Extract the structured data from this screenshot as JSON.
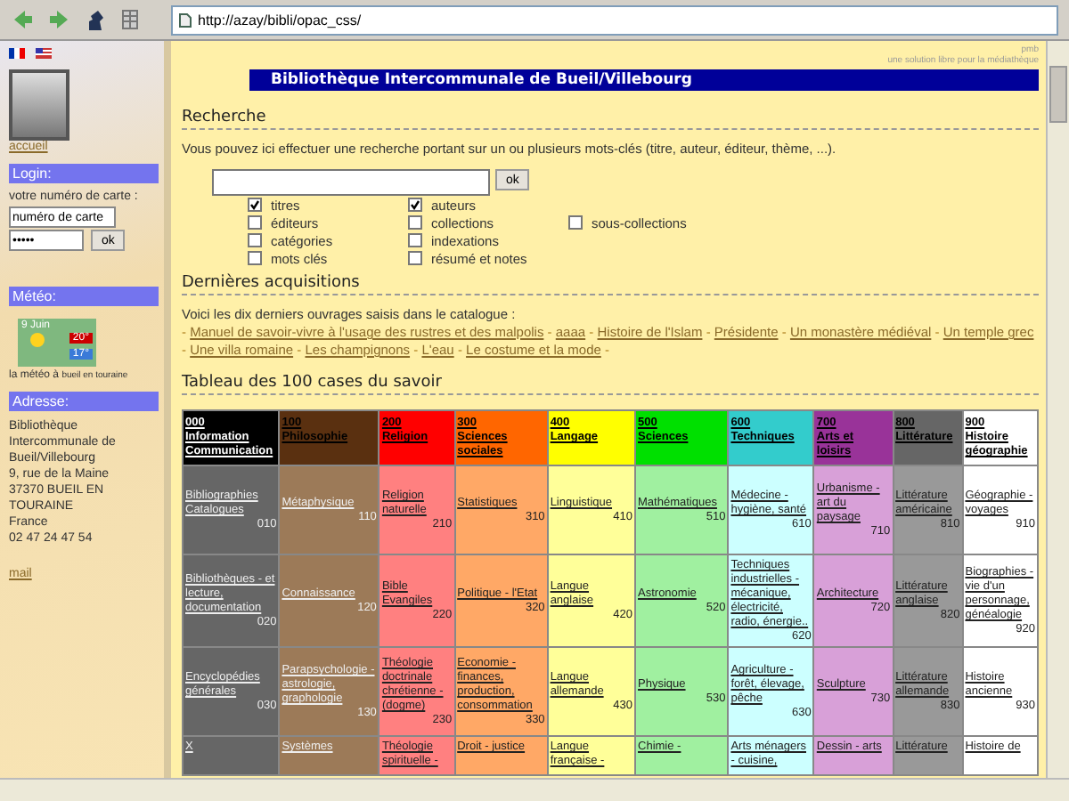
{
  "browser": {
    "url": "http://azay/bibli/opac_css/"
  },
  "sidebar": {
    "home_link": "accueil",
    "login": {
      "title": "Login:",
      "prompt": "votre numéro de carte :",
      "card_value": "numéro de carte",
      "password_value": "•••••",
      "button": "ok"
    },
    "weather": {
      "title": "Météo:",
      "date": "9 Juin",
      "high": "20°",
      "low": "17°",
      "caption": "la météo à",
      "place": "bueil en touraine"
    },
    "address": {
      "title": "Adresse:",
      "lines": [
        "Bibliothèque",
        "Intercommunale de",
        "Bueil/Villebourg",
        "9, rue de la Maine",
        "37370 BUEIL EN",
        "TOURAINE",
        "France",
        "02 47 24 47 54"
      ],
      "mail": "mail"
    }
  },
  "credit": {
    "brand": "pmb",
    "tagline": "une solution libre pour la médiathèque"
  },
  "title": "Bibliothèque Intercommunale de Bueil/Villebourg",
  "search": {
    "heading": "Recherche",
    "intro": "Vous pouvez ici effectuer une recherche portant sur un ou plusieurs mots-clés (titre, auteur, éditeur, thème, ...).",
    "button": "ok",
    "option_rows": [
      [
        {
          "label": "titres",
          "checked": true
        },
        {
          "label": "auteurs",
          "checked": true
        }
      ],
      [
        {
          "label": "éditeurs",
          "checked": false
        },
        {
          "label": "collections",
          "checked": false
        },
        {
          "label": "sous-collections",
          "checked": false
        }
      ],
      [
        {
          "label": "catégories",
          "checked": false
        },
        {
          "label": "indexations",
          "checked": false
        }
      ],
      [
        {
          "label": "mots clés",
          "checked": false
        },
        {
          "label": "résumé et notes",
          "checked": false
        }
      ]
    ]
  },
  "acquisitions": {
    "heading": "Dernières acquisitions",
    "intro": "Voici les dix derniers ouvrages saisis dans le catalogue :",
    "separator": "-",
    "titles": [
      "Manuel de savoir-vivre à l'usage des rustres et des malpolis",
      "aaaa",
      "Histoire de l'Islam",
      "Présidente",
      "Un monastère médiéval",
      "Un temple grec",
      "Une villa romaine",
      "Les champignons",
      "L'eau",
      "Le costume et la mode"
    ]
  },
  "knowledge": {
    "heading": "Tableau des 100 cases du savoir",
    "columns": [
      {
        "number": "000",
        "label": "Information Communication",
        "color": "#000000"
      },
      {
        "number": "100",
        "label": "Philosophie",
        "color": "#5a3010"
      },
      {
        "number": "200",
        "label": "Religion",
        "color": "#ff0000"
      },
      {
        "number": "300",
        "label": "Sciences sociales",
        "color": "#ff6600"
      },
      {
        "number": "400",
        "label": "Langage",
        "color": "#ffff00"
      },
      {
        "number": "500",
        "label": "Sciences",
        "color": "#00e000"
      },
      {
        "number": "600",
        "label": "Techniques",
        "color": "#33cccc"
      },
      {
        "number": "700",
        "label": "Arts et loisirs",
        "color": "#993399"
      },
      {
        "number": "800",
        "label": "Littérature",
        "color": "#666666"
      },
      {
        "number": "900",
        "label": "Histoire géographie",
        "color": "#ffffff"
      }
    ],
    "rows": [
      [
        {
          "text": "Bibliographies Catalogues",
          "code": "010",
          "color": "#666666"
        },
        {
          "text": "Métaphysique",
          "code": "110",
          "color": "#9c7a58"
        },
        {
          "text": "Religion naturelle",
          "code": "210",
          "color": "#ff8080"
        },
        {
          "text": "Statistiques",
          "code": "310",
          "color": "#ffa866"
        },
        {
          "text": "Linguistique",
          "code": "410",
          "color": "#ffff99"
        },
        {
          "text": "Mathématiques",
          "code": "510",
          "color": "#a0f0a0"
        },
        {
          "text": "Médecine - hygiène, santé",
          "code": "610",
          "color": "#ccffff"
        },
        {
          "text": "Urbanisme - art du paysage",
          "code": "710",
          "color": "#d8a0d8"
        },
        {
          "text": "Littérature américaine",
          "code": "810",
          "color": "#999999"
        },
        {
          "text": "Géographie - voyages",
          "code": "910",
          "color": "#ffffff"
        }
      ],
      [
        {
          "text": "Bibliothèques - et lecture, documentation",
          "code": "020",
          "color": "#666666"
        },
        {
          "text": "Connaissance",
          "code": "120",
          "color": "#9c7a58"
        },
        {
          "text": "Bible Evangiles",
          "code": "220",
          "color": "#ff8080"
        },
        {
          "text": "Politique - l'Etat",
          "code": "320",
          "color": "#ffa866"
        },
        {
          "text": "Langue anglaise",
          "code": "420",
          "color": "#ffff99"
        },
        {
          "text": "Astronomie",
          "code": "520",
          "color": "#a0f0a0"
        },
        {
          "text": "Techniques industrielles - mécanique, électricité, radio, énergie..",
          "code": "620",
          "color": "#ccffff"
        },
        {
          "text": "Architecture",
          "code": "720",
          "color": "#d8a0d8"
        },
        {
          "text": "Littérature anglaise",
          "code": "820",
          "color": "#999999"
        },
        {
          "text": "Biographies - vie d'un personnage, généalogie",
          "code": "920",
          "color": "#ffffff"
        }
      ],
      [
        {
          "text": "Encyclopédies générales",
          "code": "030",
          "color": "#666666"
        },
        {
          "text": "Parapsychologie - astrologie, graphologie",
          "code": "130",
          "color": "#9c7a58"
        },
        {
          "text": "Théologie doctrinale chrétienne - (dogme)",
          "code": "230",
          "color": "#ff8080"
        },
        {
          "text": "Economie - finances, production, consommation",
          "code": "330",
          "color": "#ffa866"
        },
        {
          "text": "Langue allemande",
          "code": "430",
          "color": "#ffff99"
        },
        {
          "text": "Physique",
          "code": "530",
          "color": "#a0f0a0"
        },
        {
          "text": "Agriculture - forêt, élevage, pêche",
          "code": "630",
          "color": "#ccffff"
        },
        {
          "text": "Sculpture",
          "code": "730",
          "color": "#d8a0d8"
        },
        {
          "text": "Littérature allemande",
          "code": "830",
          "color": "#999999"
        },
        {
          "text": "Histoire ancienne",
          "code": "930",
          "color": "#ffffff"
        }
      ],
      [
        {
          "text": "X",
          "color": "#666666"
        },
        {
          "text": "Systèmes",
          "color": "#9c7a58"
        },
        {
          "text": "Théologie spirituelle -",
          "color": "#ff8080"
        },
        {
          "text": "Droit - justice",
          "color": "#ffa866"
        },
        {
          "text": "Langue française -",
          "color": "#ffff99"
        },
        {
          "text": "Chimie -",
          "color": "#a0f0a0"
        },
        {
          "text": "Arts ménagers - cuisine,",
          "color": "#ccffff"
        },
        {
          "text": "Dessin - arts",
          "color": "#d8a0d8"
        },
        {
          "text": "Littérature",
          "color": "#999999"
        },
        {
          "text": "Histoire de",
          "color": "#ffffff"
        }
      ]
    ]
  }
}
